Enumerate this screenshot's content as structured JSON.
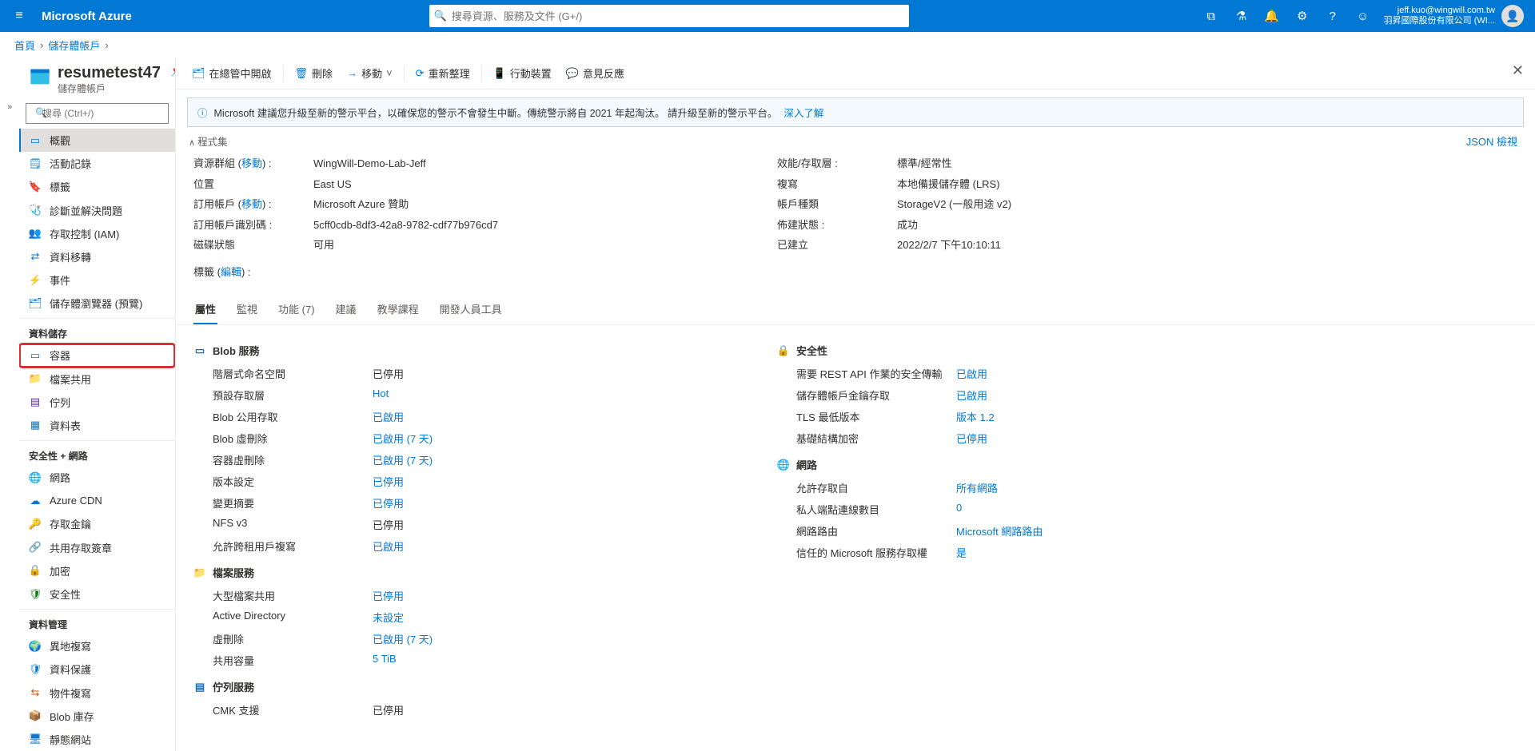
{
  "top": {
    "brand": "Microsoft Azure",
    "search_placeholder": "搜尋資源、服務及文件 (G+/)",
    "account_email": "jeff.kuo@wingwill.com.tw",
    "account_org": "羽昇國際股份有限公司 (WI..."
  },
  "crumbs": {
    "home": "首頁",
    "storage": "儲存體帳戶"
  },
  "header": {
    "title": "resumetest47",
    "subtitle": "儲存體帳戶"
  },
  "side_search_placeholder": "搜尋 (Ctrl+/)",
  "nav": {
    "overview": "概觀",
    "activity": "活動記錄",
    "tags": "標籤",
    "diagnose": "診斷並解決問題",
    "iam": "存取控制 (IAM)",
    "datamigration": "資料移轉",
    "events": "事件",
    "explorer": "儲存體瀏覽器 (預覽)",
    "sec_storage": "資料儲存",
    "containers": "容器",
    "fileshare": "檔案共用",
    "queues": "佇列",
    "tables": "資料表",
    "sec_secnet": "安全性 + 網路",
    "networking": "網路",
    "cdn": "Azure CDN",
    "keys": "存取金鑰",
    "sas": "共用存取簽章",
    "encryption": "加密",
    "security": "安全性",
    "sec_datamgmt": "資料管理",
    "redundancy": "異地複寫",
    "data_protection": "資料保護",
    "object_replication": "物件複寫",
    "blob_inventory": "Blob 庫存",
    "static_website": "靜態網站"
  },
  "cmd": {
    "open_explorer": "在總管中開啟",
    "delete": "刪除",
    "move": "移動",
    "refresh": "重新整理",
    "mobile": "行動裝置",
    "feedback": "意見反應"
  },
  "banner": {
    "text": "Microsoft 建議您升級至新的警示平台，以確保您的警示不會發生中斷。傳統警示將自 2021 年起淘汰。 請升級至新的警示平台。",
    "link": "深入了解"
  },
  "essentials_label": "程式集",
  "json_link": "JSON 檢視",
  "props_left": {
    "rg_label": "資源群組 (",
    "rg_move": "移動",
    "rg_close": ")  :",
    "rg_value": "WingWill-Demo-Lab-Jeff",
    "loc_label": "位置",
    "loc_value": "East US",
    "sub_label": "訂用帳戶 (",
    "sub_move": "移動",
    "sub_close": ")  :",
    "sub_value": "Microsoft Azure 贊助",
    "subid_label": "訂用帳戶識別碼 :",
    "subid_value": "5cff0cdb-8df3-42a8-9782-cdf77b976cd7",
    "disk_label": "磁碟狀態",
    "disk_value": "可用",
    "tags_label": "標籤 (",
    "tags_edit": "編輯",
    "tags_close": ") :"
  },
  "props_right": {
    "sku_label": "效能/存取層 :",
    "sku_value": "標準/經常性",
    "repl_label": "複寫",
    "repl_value": "本地備援儲存體 (LRS)",
    "kind_label": "帳戶種類",
    "kind_value": "StorageV2 (一般用途 v2)",
    "prov_label": "佈建狀態 :",
    "prov_value": "成功",
    "created_label": "已建立",
    "created_value": "2022/2/7 下午10:10:11"
  },
  "tabs": {
    "properties": "屬性",
    "monitor": "監視",
    "capabilities": "功能 (7)",
    "recommend": "建議",
    "tutorials": "教學課程",
    "devtools": "開發人員工具"
  },
  "groups": {
    "blob": {
      "title": "Blob 服務",
      "rows": [
        {
          "l": "階層式命名空間",
          "v": "已停用",
          "link": false
        },
        {
          "l": "預設存取層",
          "v": "Hot",
          "link": true
        },
        {
          "l": "Blob 公用存取",
          "v": "已啟用",
          "link": true
        },
        {
          "l": "Blob 虛刪除",
          "v": "已啟用 (7 天)",
          "link": true
        },
        {
          "l": "容器虛刪除",
          "v": "已啟用 (7 天)",
          "link": true
        },
        {
          "l": "版本設定",
          "v": "已停用",
          "link": true
        },
        {
          "l": "變更摘要",
          "v": "已停用",
          "link": true
        },
        {
          "l": "NFS v3",
          "v": "已停用",
          "link": false
        },
        {
          "l": "允許跨租用戶複寫",
          "v": "已啟用",
          "link": true
        }
      ]
    },
    "file": {
      "title": "檔案服務",
      "rows": [
        {
          "l": "大型檔案共用",
          "v": "已停用",
          "link": true
        },
        {
          "l": "Active Directory",
          "v": "未設定",
          "link": true
        },
        {
          "l": "虛刪除",
          "v": "已啟用 (7 天)",
          "link": true
        },
        {
          "l": "共用容量",
          "v": "5 TiB",
          "link": true
        }
      ]
    },
    "queue": {
      "title": "佇列服務",
      "rows": [
        {
          "l": "CMK 支援",
          "v": "已停用",
          "link": false
        }
      ]
    },
    "security": {
      "title": "安全性",
      "rows": [
        {
          "l": "需要 REST API 作業的安全傳輸",
          "v": "已啟用",
          "link": true
        },
        {
          "l": "儲存體帳戶金鑰存取",
          "v": "已啟用",
          "link": true
        },
        {
          "l": "TLS 最低版本",
          "v": "版本 1.2",
          "link": true
        },
        {
          "l": "基礎結構加密",
          "v": "已停用",
          "link": true
        }
      ]
    },
    "network": {
      "title": "網路",
      "rows": [
        {
          "l": "允許存取自",
          "v": "所有網路",
          "link": true
        },
        {
          "l": "私人端點連線數目",
          "v": "0",
          "link": true
        },
        {
          "l": "網路路由",
          "v": "Microsoft 網路路由",
          "link": true
        },
        {
          "l": "信任的 Microsoft 服務存取權",
          "v": "是",
          "link": true
        }
      ]
    }
  }
}
